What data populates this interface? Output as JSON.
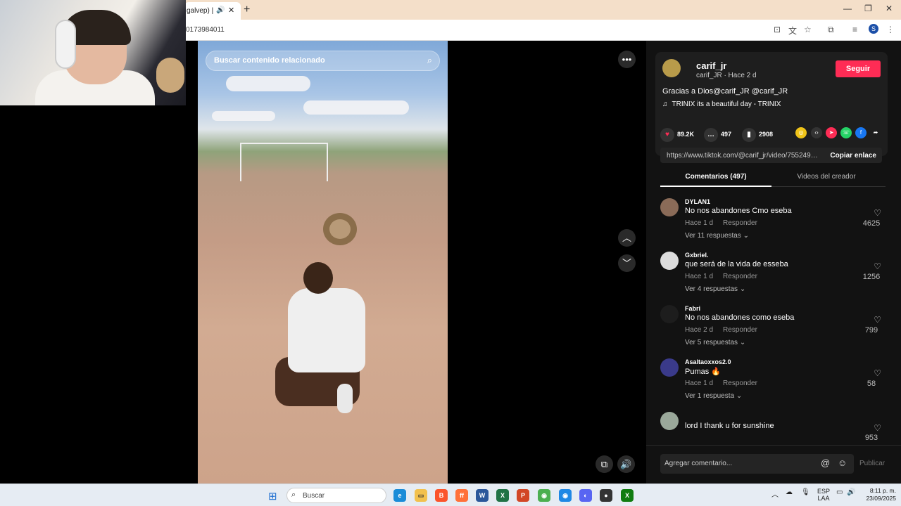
{
  "browser": {
    "tab_title": "galvep) | Ti",
    "url": "0173984011",
    "profile_initial": "S"
  },
  "video": {
    "search_placeholder": "Buscar contenido relacionado"
  },
  "author": {
    "name": "carif_jr",
    "sub": "carif_JR · Hace 2 d",
    "follow_label": "Seguir",
    "description": "Gracias a Dios@carif_JR @carif_JR",
    "music": "TRINIX its a beautiful day - TRINIX"
  },
  "stats": {
    "likes": "89.2K",
    "comments": "497",
    "saves": "2908"
  },
  "link": {
    "url": "https://www.tiktok.com/@carif_jr/video/7552498...",
    "copy_label": "Copiar enlace"
  },
  "tabs": {
    "comments": "Comentarios (497)",
    "creator_videos": "Videos del creador"
  },
  "comments": [
    {
      "user": "DYLAN1",
      "text": "No nos abandones Cmo eseba",
      "time": "Hace 1 d",
      "reply": "Responder",
      "replies": "Ver 11 respuestas ⌄",
      "likes": "4625"
    },
    {
      "user": "Gxbriel.",
      "text": "que será de la vida de esseba",
      "time": "Hace 1 d",
      "reply": "Responder",
      "replies": "Ver 4 respuestas ⌄",
      "likes": "1256"
    },
    {
      "user": "Fabri",
      "text": "No nos abandones como eseba",
      "time": "Hace 2 d",
      "reply": "Responder",
      "replies": "Ver 5 respuestas ⌄",
      "likes": "799"
    },
    {
      "user": "Asaltaoxxos2.0",
      "text": "Pumas 🔥",
      "time": "Hace 1 d",
      "reply": "Responder",
      "replies": "Ver 1 respuesta ⌄",
      "likes": "58"
    },
    {
      "user": "",
      "text": "lord I thank u for sunshine",
      "time": "",
      "reply": "",
      "replies": "",
      "likes": "953"
    }
  ],
  "comment_bar": {
    "placeholder": "Agregar comentario...",
    "publish_label": "Publicar"
  },
  "taskbar": {
    "search_label": "Buscar",
    "lang_top": "ESP",
    "lang_bottom": "LAA",
    "time": "8:11 p. m.",
    "date": "23/09/2025"
  },
  "icons": {
    "accent_follow": "#fe2c55",
    "like_color": "#fe2c55"
  }
}
